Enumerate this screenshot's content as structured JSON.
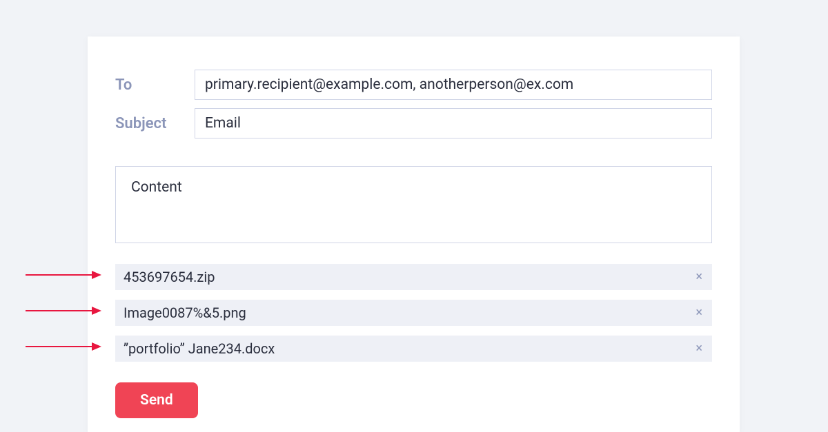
{
  "form": {
    "to_label": "To",
    "to_value": "primary.recipient@example.com, anotherperson@ex.com",
    "subject_label": "Subject",
    "subject_value": "Email",
    "content_value": "Content"
  },
  "attachments": [
    "453697654.zip",
    "Image0087%&5.png",
    "”portfolio” Jane234.docx"
  ],
  "send_label": "Send"
}
